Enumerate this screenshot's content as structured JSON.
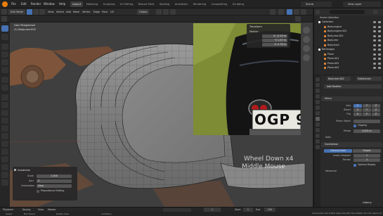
{
  "topbar": {
    "menus": [
      "File",
      "Edit",
      "Render",
      "Window",
      "Help"
    ],
    "workspaces": [
      "Layout",
      "Modeling",
      "Sculpting",
      "UV Editing",
      "Texture Paint",
      "Shading",
      "Animation",
      "Rendering",
      "Compositing",
      "Scripting"
    ],
    "active_workspace": "Layout",
    "scene": "Scene",
    "view_layer": "View Layer"
  },
  "viewport_header": {
    "mode": "Edit Mode",
    "view": "View",
    "select": "Select",
    "add": "Add",
    "mesh": "Mesh",
    "vertex": "Vertex",
    "edge": "Edge",
    "face": "Face",
    "uv": "UV",
    "orientation": "Global"
  },
  "viewport_info": {
    "view_name": "User Perspective",
    "object_name": "(1) Body.rear.002"
  },
  "transform_panel": {
    "title": "Transform",
    "subtitle": "Median:",
    "x": "X: -0.19 m",
    "y": "Y: 1.57 m",
    "z": "Z: 0.78 m"
  },
  "overlay": {
    "line1": "Wheel Down x4",
    "line2": "Middle Mouse"
  },
  "reference_photo": {
    "plate": "OGP 9"
  },
  "redo_panel": {
    "title": "Subdivide",
    "rows": [
      {
        "label": "Scale",
        "value": "1.000"
      },
      {
        "label": "Axis",
        "value": "Z"
      },
      {
        "label": "Orientation",
        "value": "View"
      }
    ],
    "checkbox": "Proportional Editing"
  },
  "outliner": {
    "header": "Scene Collection",
    "rows": [
      {
        "name": "Collection",
        "indent": 0,
        "color": "#ffffff"
      },
      {
        "name": "Body.engine",
        "indent": 1,
        "color": "#e88b38"
      },
      {
        "name": "Body.engine.001",
        "indent": 1,
        "color": "#e88b38"
      },
      {
        "name": "Body.rear.002",
        "indent": 1,
        "color": "#e88b38"
      },
      {
        "name": "Body.rear",
        "indent": 1,
        "color": "#e88b38"
      },
      {
        "name": "Body.front",
        "indent": 1,
        "color": "#e88b38"
      },
      {
        "name": "Ref.images",
        "indent": 0,
        "color": "#ffffff"
      },
      {
        "name": "Plane",
        "indent": 1,
        "color": "#e88b38"
      },
      {
        "name": "Plane.001",
        "indent": 1,
        "color": "#e88b38"
      },
      {
        "name": "Plane.002",
        "indent": 1,
        "color": "#e88b38"
      },
      {
        "name": "Plane.003",
        "indent": 1,
        "color": "#e88b38"
      }
    ]
  },
  "properties": {
    "object_name": "Body.rear.002",
    "modifier_name": "Subdivision",
    "add_modifier": "Add Modifier",
    "mirror": {
      "title": "Mirror",
      "axis_label": "Axis",
      "bisect_label": "Bisect",
      "flip_label": "Flip",
      "xyz": [
        "X",
        "Y",
        "Z"
      ],
      "mirror_object_label": "Mirror Object",
      "clipping": "Clipping",
      "merge_label": "Merge",
      "merge_value": "0.001 m",
      "data": "Data"
    },
    "subdivision": {
      "title": "Subdivision",
      "catmull": "Catmull-Clark",
      "simple": "Simple",
      "levels_viewport_label": "Levels Viewport",
      "levels_viewport": "1",
      "render_label": "Render",
      "render": "2",
      "optimal_display": "Optimal Display",
      "advanced": "Advanced"
    }
  },
  "timeline": {
    "playback": "Playback",
    "keying": "Keying",
    "view": "View",
    "marker": "Marker",
    "frame": "1",
    "start_label": "Start",
    "start": "1",
    "end_label": "End",
    "end": "250"
  },
  "statusbar": {
    "select": "Select",
    "box_select": "Box Select",
    "rotate_view": "Rotate View",
    "call_menu": "Call Menu",
    "stats": "Body.rear.002 | Verts 216/832 | Edges 416/1,648 | Faces 200/816 | Tris 1,632 | Objects 1/4"
  },
  "watermark": "Udemy",
  "colors": {
    "accent": "#4772b3",
    "selection": "#e88b38",
    "viewport_bg": "#3f3f3f"
  }
}
